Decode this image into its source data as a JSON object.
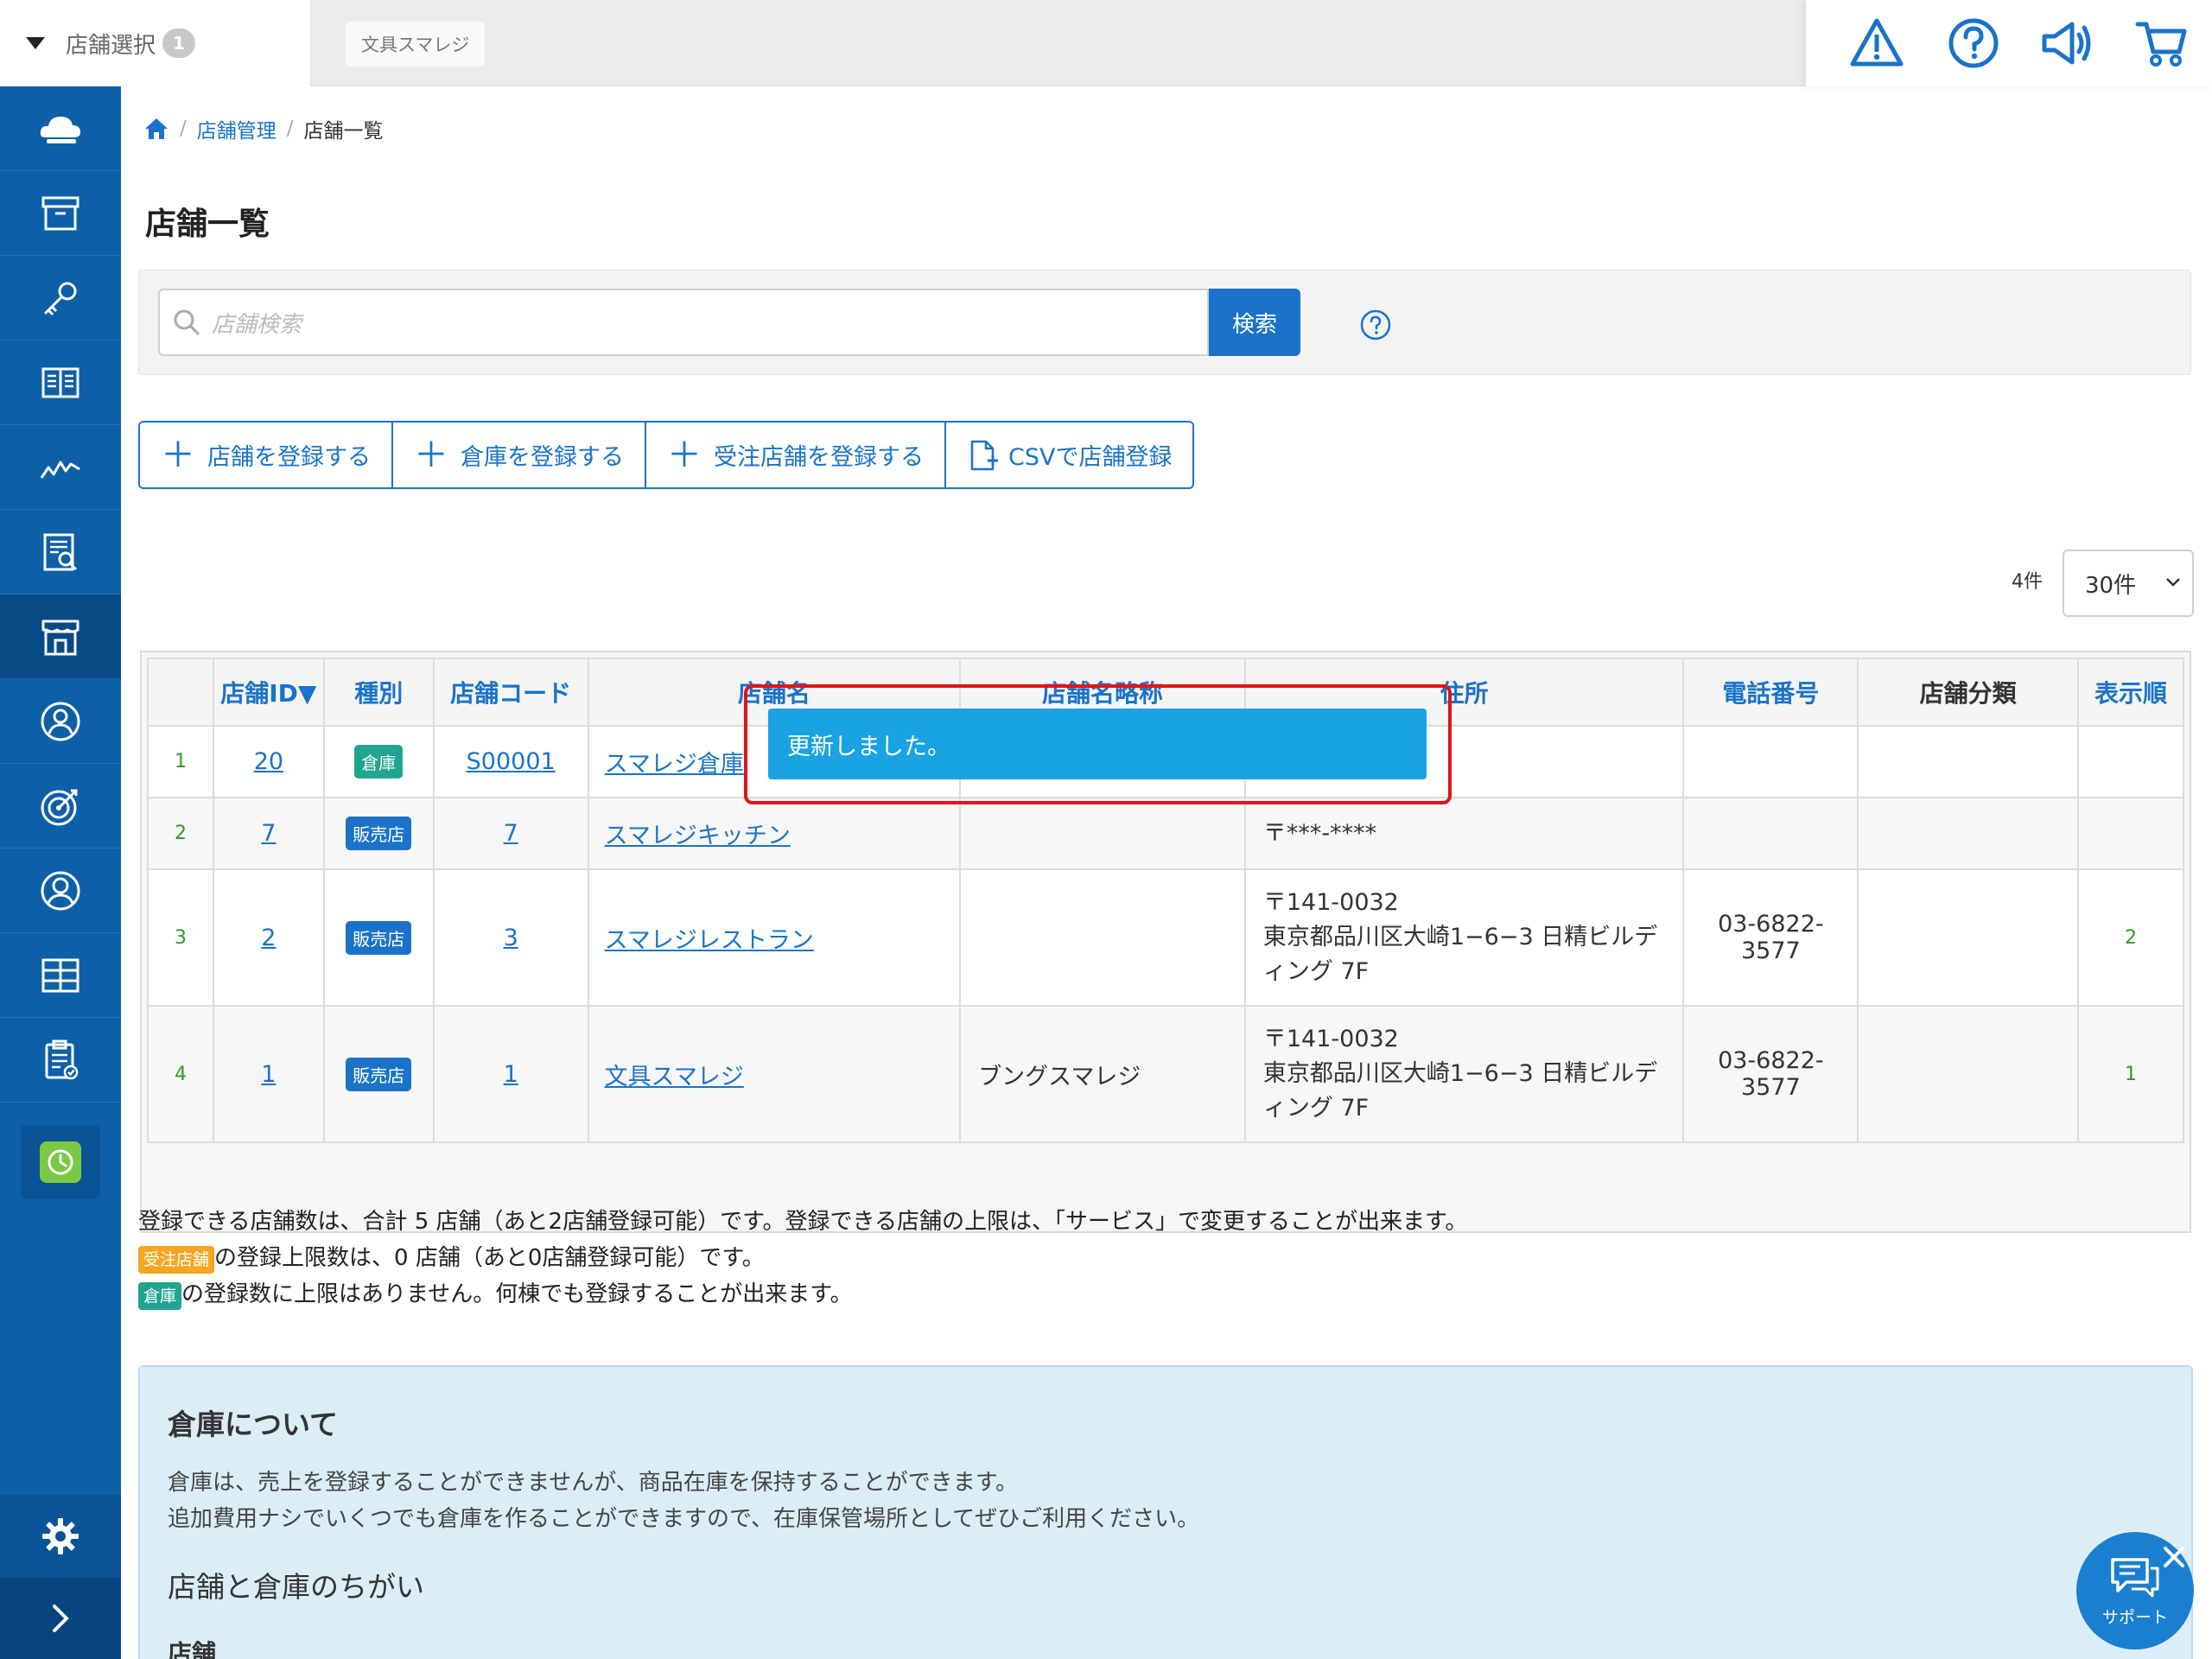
{
  "topbar": {
    "store_select_label": "店舗選択",
    "store_select_count": "1",
    "current_store": "文具スマレジ"
  },
  "breadcrumb": {
    "level1": "店舗管理",
    "current": "店舗一覧"
  },
  "page_title": "店舗一覧",
  "search": {
    "placeholder": "店舗検索",
    "button_label": "検索"
  },
  "actions": {
    "register_store": "店舗を登録する",
    "register_warehouse": "倉庫を登録する",
    "register_order_store": "受注店舗を登録する",
    "csv_register": "CSVで店舗登録"
  },
  "list_controls": {
    "result_count": "4件",
    "per_page": "30件"
  },
  "table": {
    "headers": {
      "store_id": "店舗ID▼",
      "type": "種別",
      "store_code": "店舗コード",
      "store_name": "店舗名",
      "store_short_name": "店舗名略称",
      "address": "住所",
      "phone": "電話番号",
      "category": "店舗分類",
      "order": "表示順"
    },
    "rows": [
      {
        "no": "1",
        "id": "20",
        "type": "倉庫",
        "code": "S00001",
        "name": "スマレジ倉庫",
        "short": "",
        "zip": "",
        "addr": "",
        "phone": "",
        "category": "",
        "order": ""
      },
      {
        "no": "2",
        "id": "7",
        "type": "販売店",
        "code": "7",
        "name": "スマレジキッチン",
        "short": "",
        "zip": "〒***-****",
        "addr": "",
        "phone": "",
        "category": "",
        "order": ""
      },
      {
        "no": "3",
        "id": "2",
        "type": "販売店",
        "code": "3",
        "name": "スマレジレストラン",
        "short": "",
        "zip": "〒141-0032",
        "addr1": "東京都品川区大崎1−6−3 日精ビルデ",
        "addr2": "ィング 7F",
        "phone1": "03-6822-",
        "phone2": "3577",
        "category": "",
        "order": "2"
      },
      {
        "no": "4",
        "id": "1",
        "type": "販売店",
        "code": "1",
        "name": "文具スマレジ",
        "short": "ブングスマレジ",
        "zip": "〒141-0032",
        "addr1": "東京都品川区大崎1−6−3 日精ビルデ",
        "addr2": "ィング 7F",
        "phone1": "03-6822-",
        "phone2": "3577",
        "category": "",
        "order": "1"
      }
    ]
  },
  "toast": {
    "message": "更新しました。"
  },
  "notes": {
    "line1": "登録できる店舗数は、合計 5 店舗（あと2店舗登録可能）です。登録できる店舗の上限は、「サービス」で変更することが出来ます。",
    "order_tag": "受注店舗",
    "line2": "の登録上限数は、0 店舗（あと0店舗登録可能）です。",
    "warehouse_tag": "倉庫",
    "line3": "の登録数に上限はありません。何棟でも登録することが出来ます。"
  },
  "info_panel": {
    "title": "倉庫について",
    "p1": "倉庫は、売上を登録することができませんが、商品在庫を保持することができます。",
    "p2": "追加費用ナシでいくつでも倉庫を作ることができますので、在庫保管場所としてぜひご利用ください。",
    "subtitle": "店舗と倉庫のちがい",
    "subheading": "店舗"
  },
  "support": {
    "label": "サポート"
  },
  "colors": {
    "primary": "#1a73c9",
    "sidebar": "#0d5fa8",
    "toast": "#19a3e3",
    "highlight_outline": "#e1141b",
    "warehouse_badge": "#1fa590",
    "order_badge": "#f5a623"
  },
  "icons": {
    "top": [
      "warning-icon",
      "help-icon",
      "megaphone-icon",
      "cart-icon"
    ],
    "sidebar": [
      "cloud-icon",
      "archive-icon",
      "key-icon",
      "book-icon",
      "chart-icon",
      "report-icon",
      "store-icon",
      "user-circle-icon",
      "target-icon",
      "member-icon",
      "grid-icon",
      "clipboard-icon",
      "clock-icon",
      "gear-icon",
      "chevron-right-icon"
    ]
  }
}
